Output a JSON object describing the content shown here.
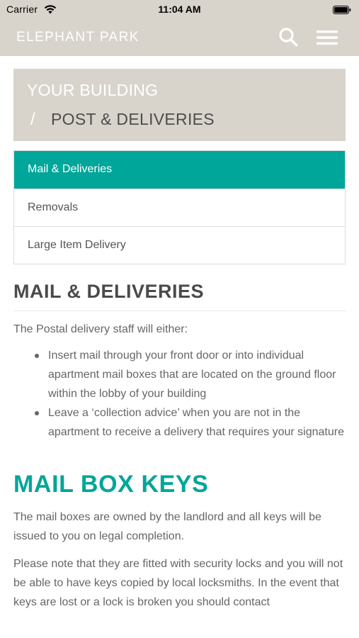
{
  "status_bar": {
    "carrier": "Carrier",
    "time": "11:04 AM"
  },
  "header": {
    "brand": "ELEPHANT PARK",
    "search_icon": "search-icon",
    "menu_icon": "hamburger-menu-icon",
    "background_color": "#d8d4cc"
  },
  "breadcrumb": {
    "parent": "YOUR BUILDING",
    "separator": "/",
    "current": "POST & DELIVERIES"
  },
  "sub_nav": {
    "accent_color": "#00a699",
    "items": [
      {
        "label": "Mail & Deliveries",
        "active": true
      },
      {
        "label": "Removals",
        "active": false
      },
      {
        "label": "Large Item Delivery",
        "active": false
      }
    ]
  },
  "content": {
    "mail_heading": "MAIL & DELIVERIES",
    "intro": "The Postal delivery staff will either:",
    "bullets": [
      "Insert mail through your front door or into individual apartment mail boxes that are located on the ground floor within the lobby of your building",
      "Leave a ‘collection advice’ when you are not in the apartment to receive a delivery that requires your signature"
    ],
    "keys_heading": "MAIL BOX KEYS",
    "paragraph_1": "The mail boxes are owned by the landlord and all keys will be issued to you on legal completion.",
    "paragraph_2": "Please note that they are fitted with security locks and you will not be able to have keys copied by local locksmiths. In the event that keys are lost or a lock is broken you should contact"
  }
}
